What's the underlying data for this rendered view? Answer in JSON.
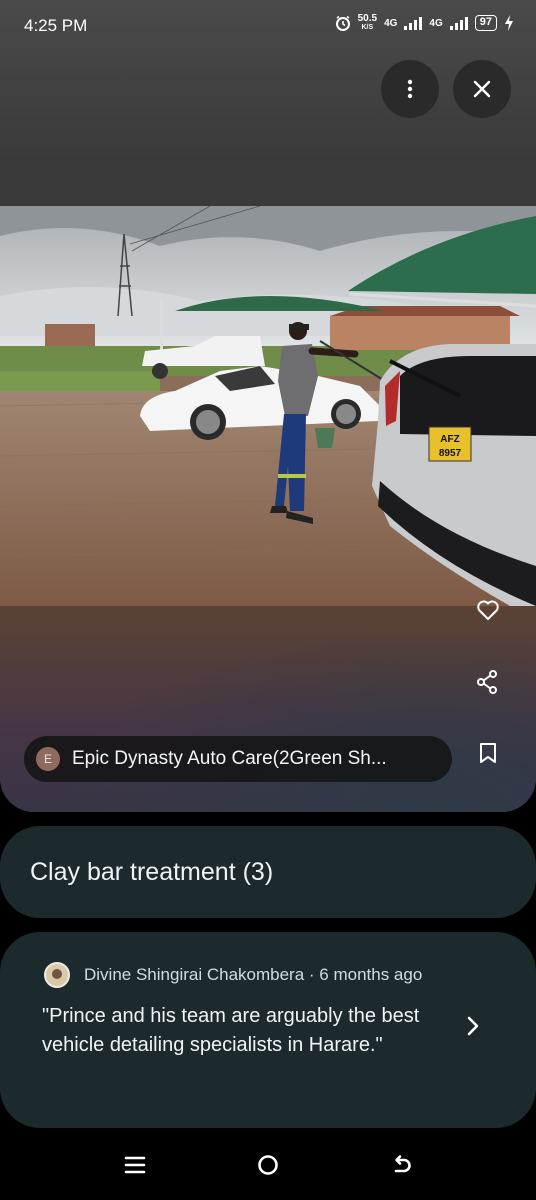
{
  "status_bar": {
    "time": "4:25 PM",
    "net_speed_value": "50.5",
    "net_speed_unit": "K/S",
    "network_1": "4G",
    "network_2": "4G",
    "battery": "97",
    "icons": [
      "alarm-icon",
      "signal-icon",
      "battery-icon",
      "charging-icon"
    ]
  },
  "viewer": {
    "more_button": "more-vert-icon",
    "close_button": "close-icon",
    "photo_plate": "AFZ 8957",
    "side_actions": [
      "heart-icon",
      "share-icon",
      "bookmark-icon"
    ]
  },
  "attribution": {
    "avatar_letter": "E",
    "name": "Epic Dynasty Auto Care(2Green Sh..."
  },
  "category": {
    "title": "Clay bar treatment (3)"
  },
  "review": {
    "author_line": "Divine Shingirai Chakombera · 6 months ago",
    "text": "\"Prince and his team are arguably the best vehicle detailing specialists in Harare.\""
  },
  "nav_bar": {
    "icons": [
      "menu-icon",
      "home-icon",
      "back-icon"
    ]
  },
  "colors": {
    "card_bg": "#1c2a2e",
    "chip_bg": "#141416"
  }
}
